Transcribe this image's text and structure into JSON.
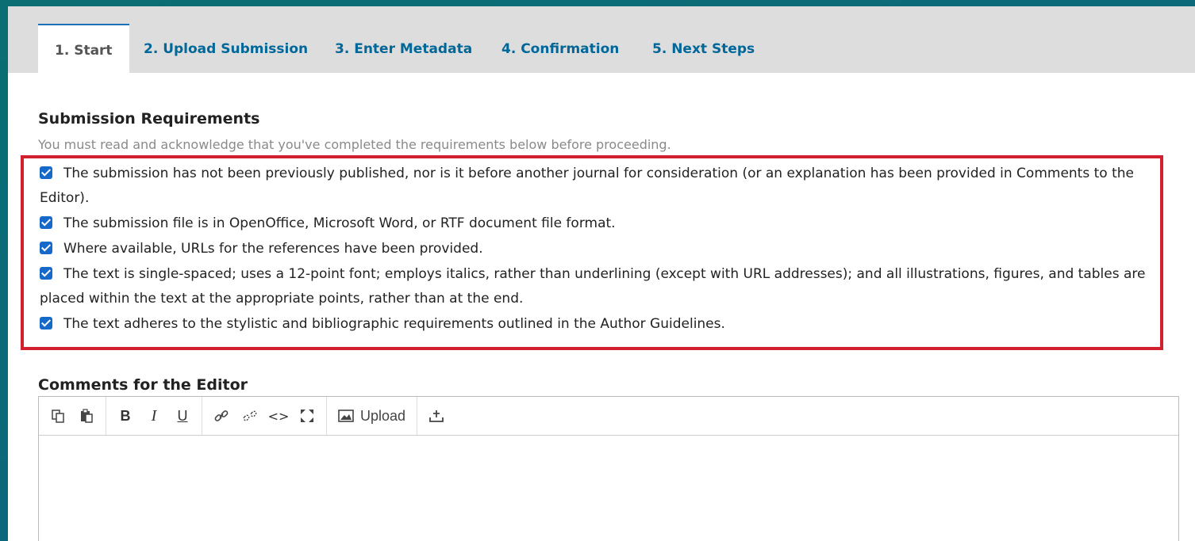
{
  "tabs": [
    {
      "label": "1. Start",
      "active": true
    },
    {
      "label": "2. Upload Submission"
    },
    {
      "label": "3. Enter Metadata"
    },
    {
      "label": "4. Confirmation"
    },
    {
      "label": "5. Next Steps"
    }
  ],
  "requirements": {
    "title": "Submission Requirements",
    "subtitle": "You must read and acknowledge that you've completed the requirements below before proceeding.",
    "items": [
      {
        "text": "The submission has not been previously published, nor is it before another journal for consideration (or an explanation has been provided in Comments to the Editor).",
        "checked": true
      },
      {
        "text": "The submission file is in OpenOffice, Microsoft Word, or RTF document file format.",
        "checked": true
      },
      {
        "text": "Where available, URLs for the references have been provided.",
        "checked": true
      },
      {
        "text": "The text is single-spaced; uses a 12-point font; employs italics, rather than underlining (except with URL addresses); and all illustrations, figures, and tables are placed within the text at the appropriate points, rather than at the end.",
        "checked": true
      },
      {
        "text": "The text adheres to the stylistic and bibliographic requirements outlined in the Author Guidelines.",
        "checked": true
      }
    ]
  },
  "comments": {
    "title": "Comments for the Editor",
    "toolbar": {
      "upload_label": "Upload",
      "icons": [
        "copy-icon",
        "paste-icon",
        "bold-icon",
        "italic-icon",
        "underline-icon",
        "link-icon",
        "unlink-icon",
        "code-icon",
        "fullscreen-icon",
        "image-icon",
        "insert-icon"
      ]
    }
  },
  "colors": {
    "tab_link": "#006798",
    "highlight_border": "#d3202e",
    "checkbox": "#1769c9"
  }
}
